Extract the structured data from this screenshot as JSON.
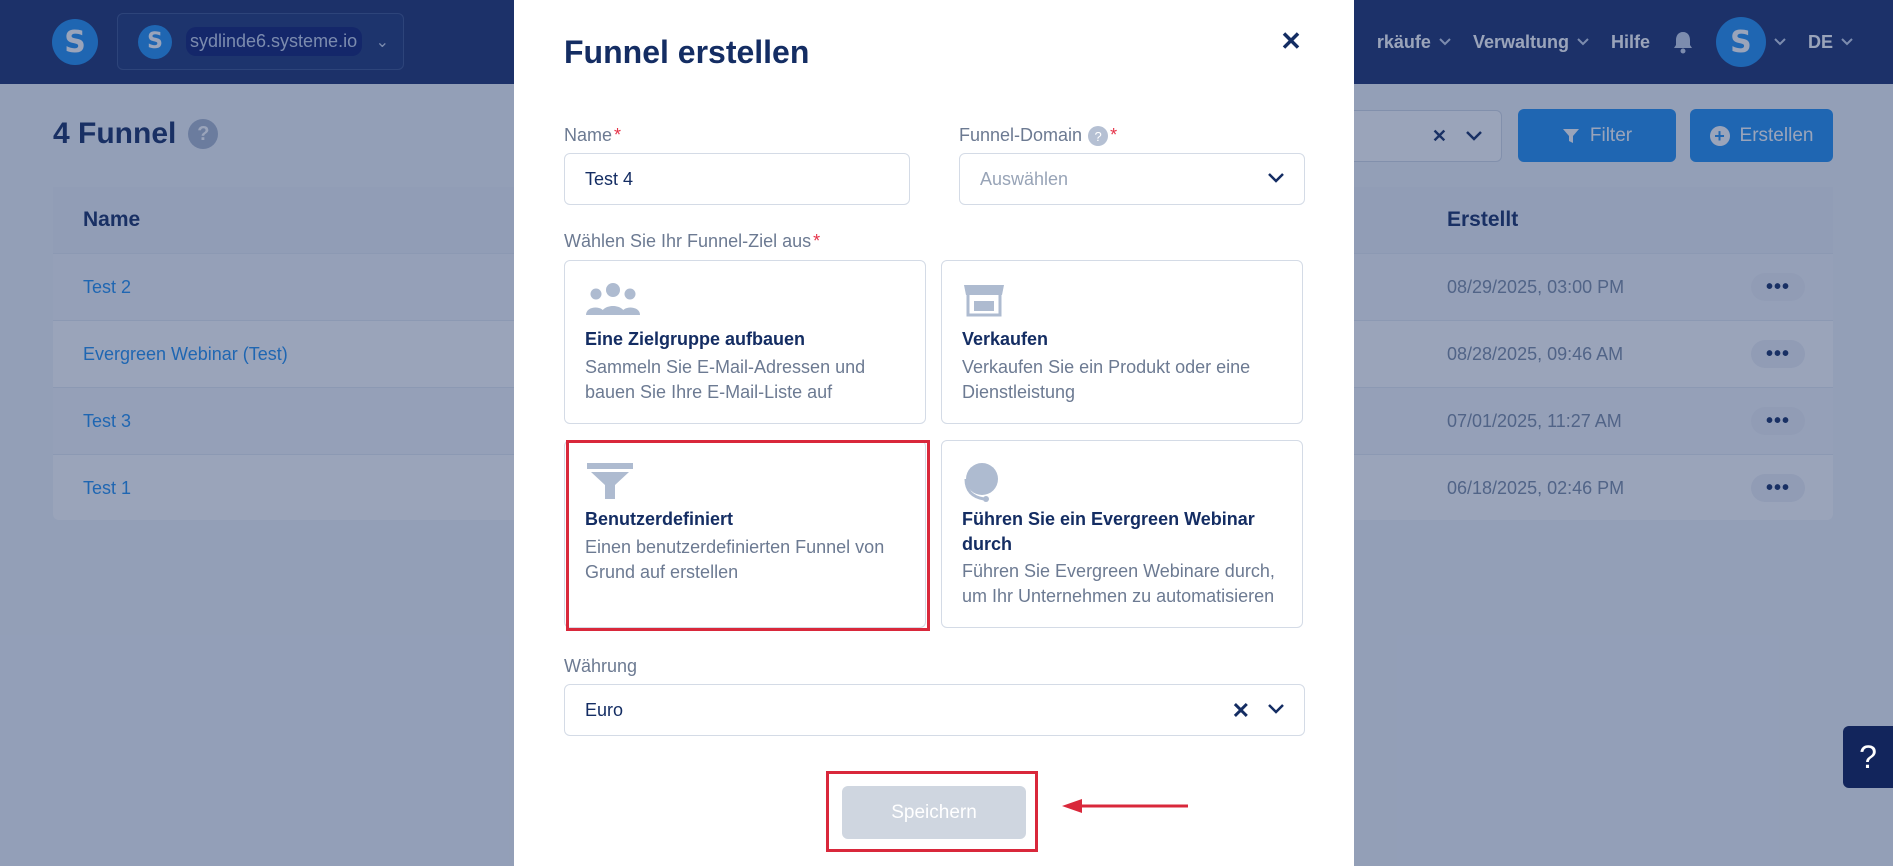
{
  "header": {
    "logo_letter": "S",
    "workspace": {
      "logo_letter": "S",
      "name": "sydlinde6.systeme.io"
    },
    "nav": [
      {
        "label": "rkäufe",
        "has_chevron": true
      },
      {
        "label": "Verwaltung",
        "has_chevron": true
      },
      {
        "label": "Hilfe",
        "has_chevron": false
      }
    ],
    "avatar_letter": "S",
    "language": "DE",
    "icons": {
      "bell": "bell-icon",
      "chevron": "chevron-down-icon"
    }
  },
  "page": {
    "title": "4 Funnel",
    "help": "?",
    "filter_label": "Filter",
    "create_label": "Erstellen",
    "table": {
      "headers": {
        "name": "Name",
        "created": "Erstellt"
      },
      "rows": [
        {
          "name": "Test 2",
          "created": "08/29/2025, 03:00 PM"
        },
        {
          "name": "Evergreen Webinar (Test)",
          "created": "08/28/2025, 09:46 AM"
        },
        {
          "name": "Test 3",
          "created": "07/01/2025, 11:27 AM"
        },
        {
          "name": "Test 1",
          "created": "06/18/2025, 02:46 PM"
        }
      ],
      "more": "•••"
    },
    "help_float": "?"
  },
  "modal": {
    "title": "Funnel erstellen",
    "close": "✕",
    "name": {
      "label": "Name",
      "required": "*",
      "value": "Test 4"
    },
    "domain": {
      "label": "Funnel-Domain",
      "required": "*",
      "help": "?",
      "placeholder": "Auswählen"
    },
    "goal": {
      "label": "Wählen Sie Ihr Funnel-Ziel aus",
      "required": "*",
      "options": [
        {
          "icon": "people-icon",
          "title": "Eine Zielgruppe aufbauen",
          "desc": "Sammeln Sie E-Mail-Adressen und bauen Sie Ihre E-Mail-Liste auf"
        },
        {
          "icon": "store-icon",
          "title": "Verkaufen",
          "desc": "Verkaufen Sie ein Produkt oder eine Dienstleistung"
        },
        {
          "icon": "funnel-icon",
          "title": "Benutzerdefiniert",
          "desc": "Einen benutzerdefinierten Funnel von Grund auf erstellen",
          "selected": true
        },
        {
          "icon": "headset-icon",
          "title": "Führen Sie ein Evergreen Webinar durch",
          "desc": "Führen Sie Evergreen Webinare durch, um Ihr Unternehmen zu automatisieren"
        }
      ]
    },
    "currency": {
      "label": "Währung",
      "value": "Euro"
    },
    "save_label": "Speichern"
  },
  "colors": {
    "primary": "#1f8ff0",
    "navy": "#142d63",
    "annotation_red": "#d9283b",
    "required_red": "#e53248",
    "disabled": "#cfd6e0"
  }
}
